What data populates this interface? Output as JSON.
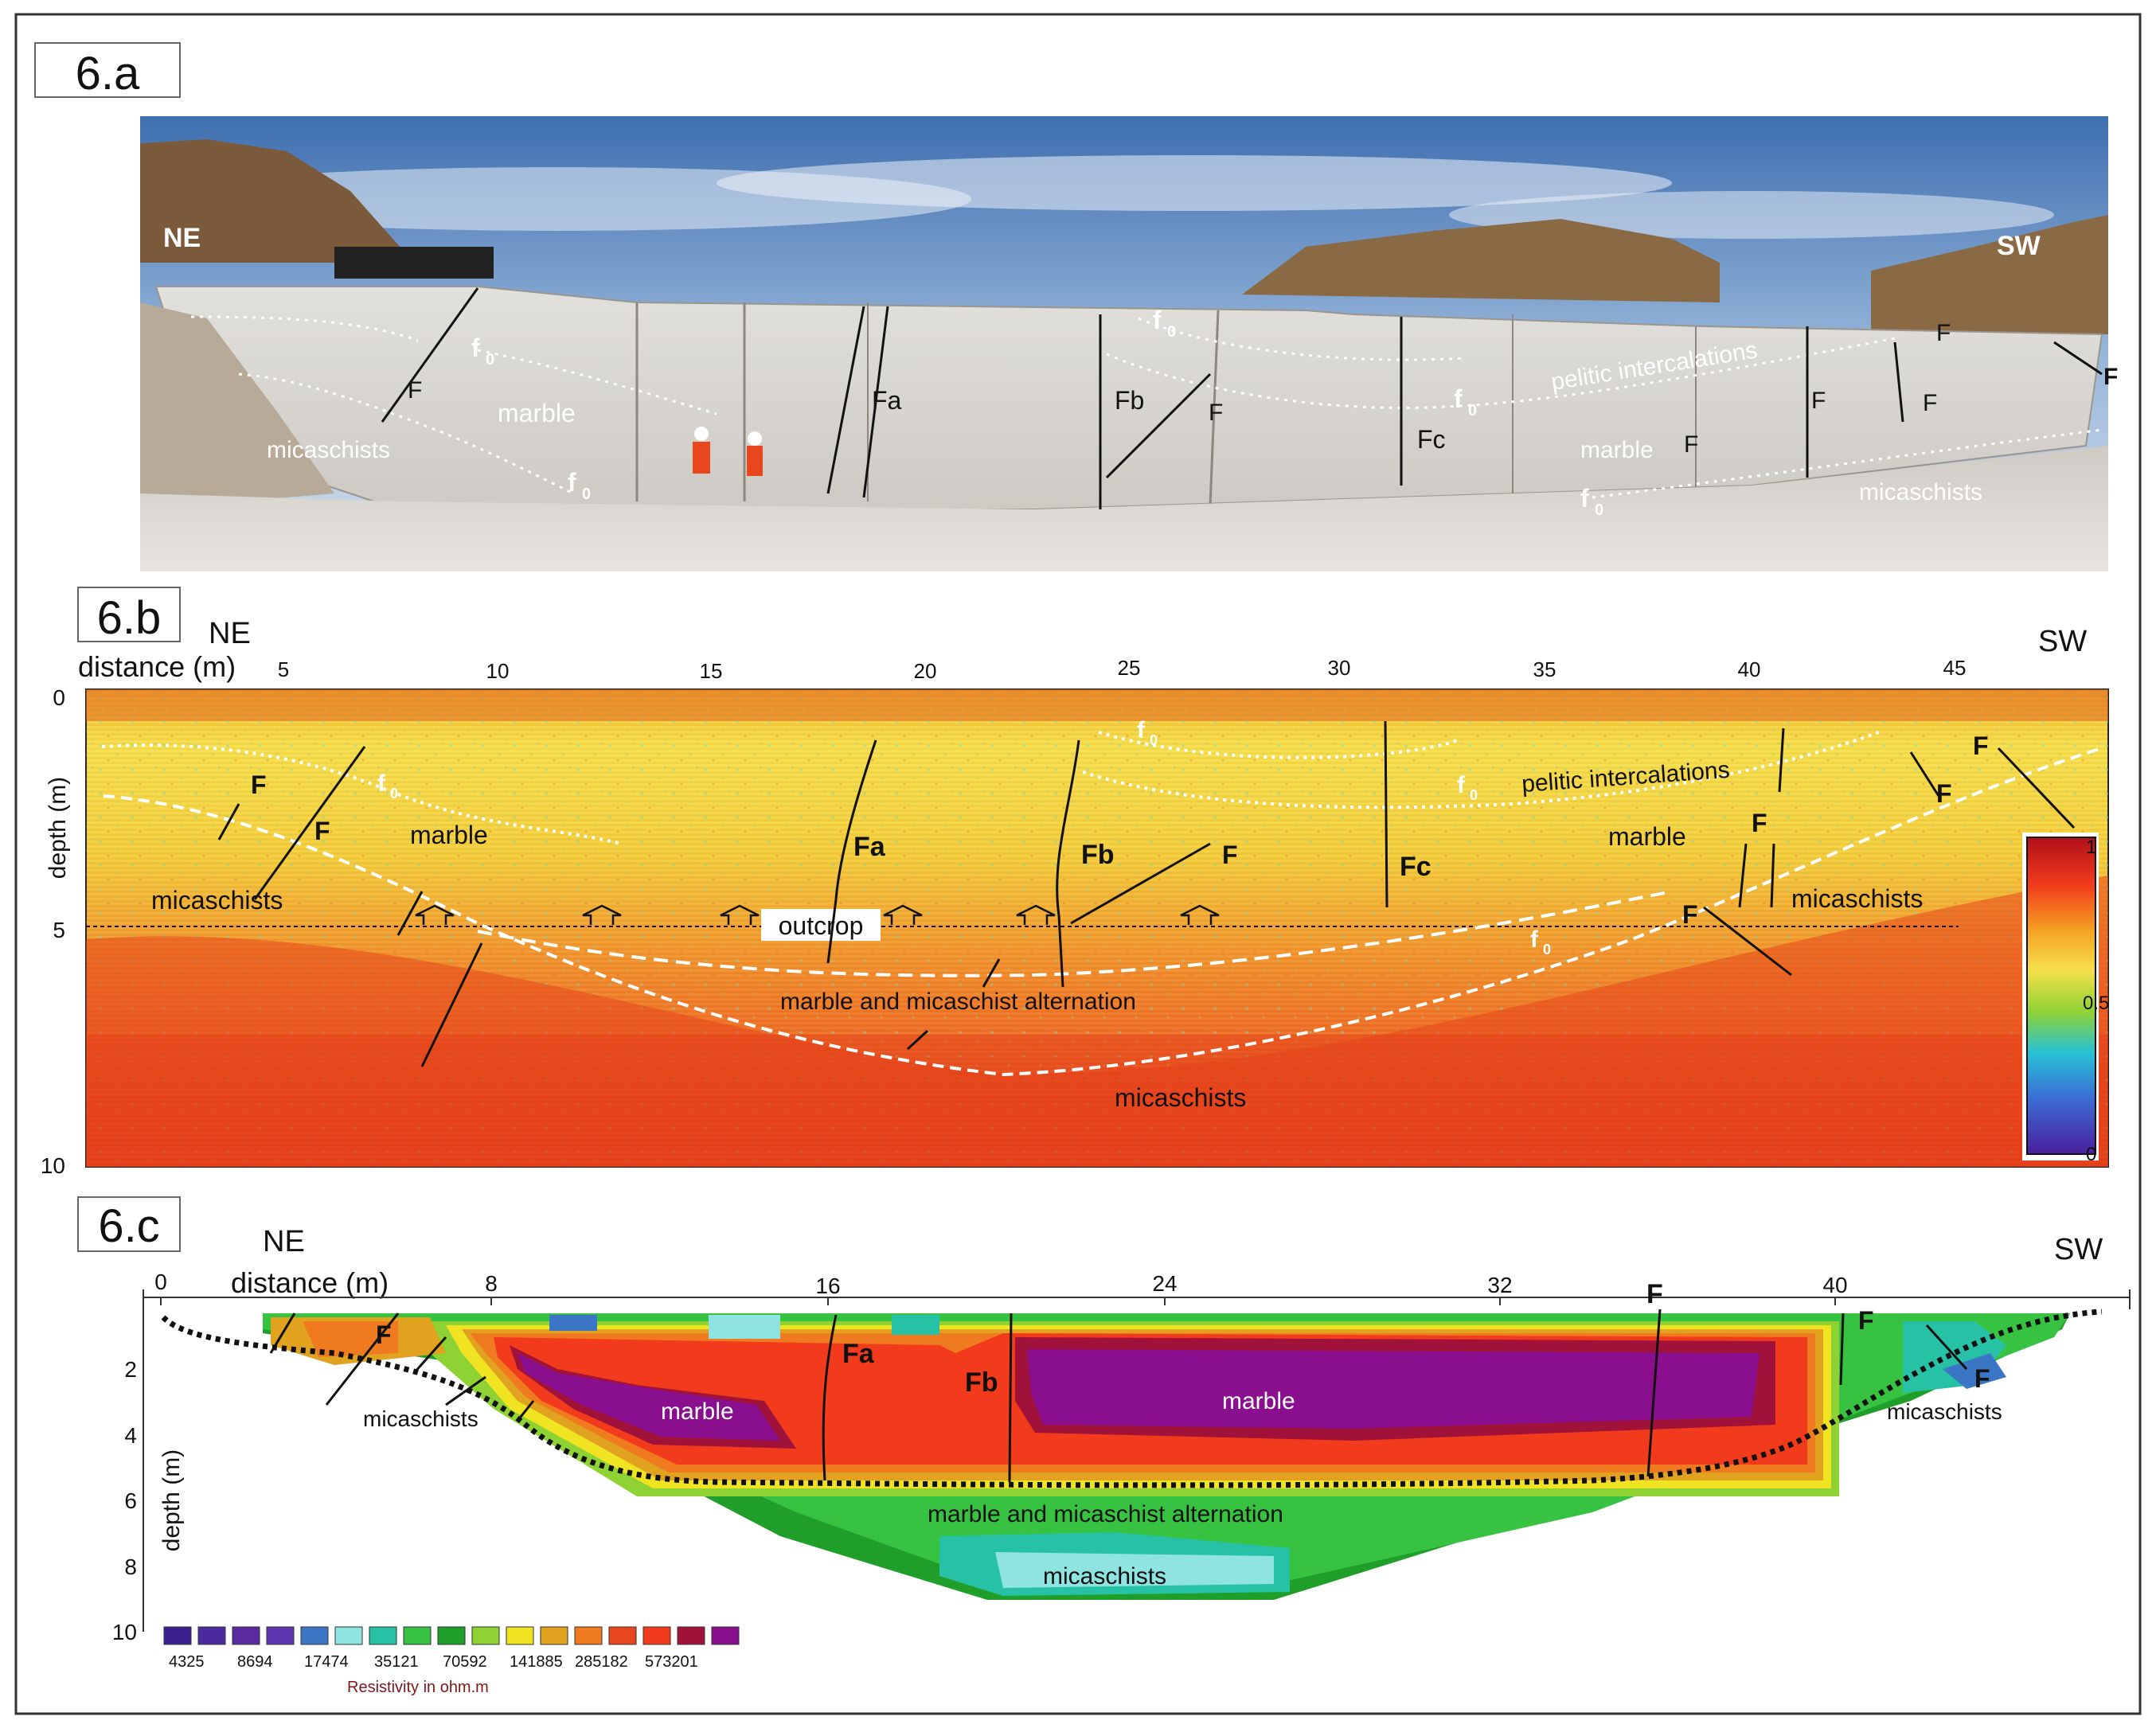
{
  "panel_a": {
    "label": "6.a",
    "dir_left": "NE",
    "dir_right": "SW",
    "labels": {
      "marble1": "marble",
      "micaschists1": "micaschists",
      "marble2": "marble",
      "micaschists2": "micaschists",
      "pelitic": "pelitic intercalations",
      "Fa": "Fa",
      "Fb": "Fb",
      "Fc": "Fc",
      "F": "F",
      "f0": "f",
      "f0_sub": "0"
    }
  },
  "panel_b": {
    "label": "6.b",
    "dir_left": "NE",
    "dir_right": "SW",
    "xaxis_label": "distance (m)",
    "yaxis_label": "depth (m)",
    "x_ticks": [
      "5",
      "10",
      "15",
      "20",
      "25",
      "30",
      "35",
      "40",
      "45"
    ],
    "y_ticks": [
      "0",
      "5",
      "10"
    ],
    "colorbar_ticks": [
      "1",
      "0.5",
      "0"
    ],
    "labels": {
      "marble1": "marble",
      "micaschists1": "micaschists",
      "marble2": "marble",
      "micaschists2": "micaschists",
      "micaschists3": "micaschists",
      "pelitic": "pelitic intercalations",
      "alternation": "marble and micaschist alternation",
      "outcrop": "outcrop",
      "Fa": "Fa",
      "Fb": "Fb",
      "Fc": "Fc",
      "F": "F",
      "f0": "f",
      "f0_sub": "0"
    }
  },
  "panel_c": {
    "label": "6.c",
    "dir_left": "NE",
    "dir_right": "SW",
    "xaxis_label": "distance (m)",
    "yaxis_label": "depth (m)",
    "x_ticks": [
      "0",
      "8",
      "16",
      "24",
      "32",
      "40"
    ],
    "y_ticks": [
      "2",
      "4",
      "6",
      "8",
      "10"
    ],
    "labels": {
      "marble1": "marble",
      "marble2": "marble",
      "micaschists1": "micaschists",
      "micaschists2": "micaschists",
      "micaschists3": "micaschists",
      "alternation": "marble and micaschist alternation",
      "Fa": "Fa",
      "Fb": "Fb",
      "F": "F"
    },
    "legend": {
      "values": [
        "4325",
        "8694",
        "17474",
        "35121",
        "70592",
        "141885",
        "285182",
        "573201"
      ],
      "title": "Resistivity in ohm.m",
      "colors": [
        "#3a1f8f",
        "#4b2a9e",
        "#5a2a9e",
        "#5e35b0",
        "#3a76c4",
        "#8fe3e0",
        "#27c2a6",
        "#37c242",
        "#1f9e2a",
        "#8fd233",
        "#f0e322",
        "#e0a21f",
        "#f07a1f",
        "#e8461c",
        "#f23b1c",
        "#a0123a",
        "#8a0f8f"
      ]
    }
  }
}
